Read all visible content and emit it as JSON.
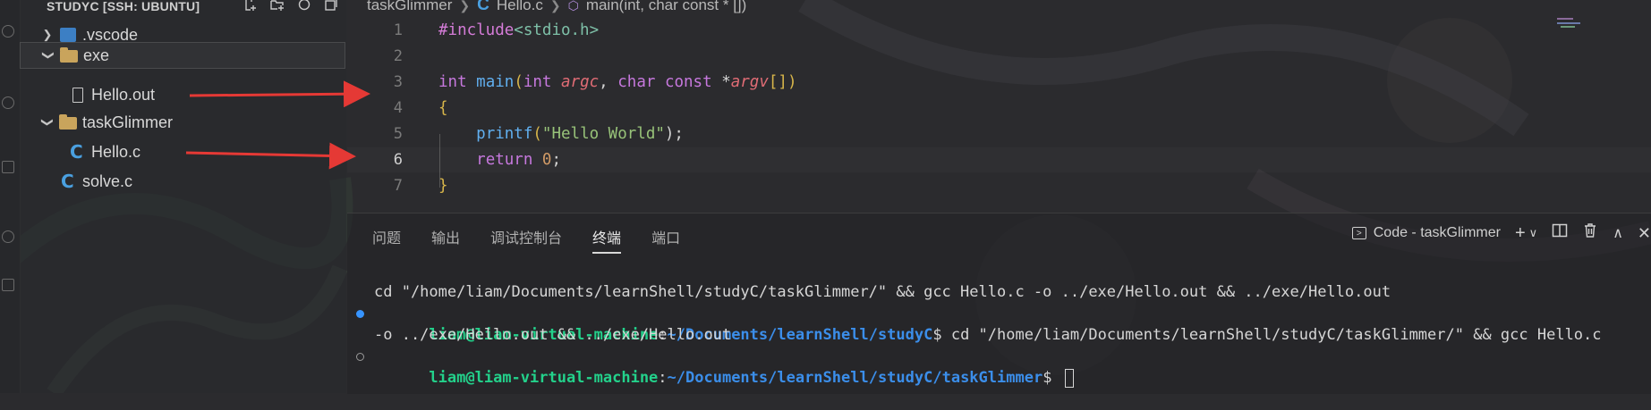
{
  "explorer": {
    "title": "STUDYC [SSH: UBUNTU]",
    "actions": [
      "new-file-icon",
      "new-folder-icon",
      "refresh-icon",
      "collapse-all-icon"
    ],
    "items": [
      {
        "label": ".vscode",
        "type": "folder-vscode",
        "expanded": false
      },
      {
        "label": "exe",
        "type": "folder",
        "expanded": true
      },
      {
        "label": "Hello.out",
        "type": "file"
      },
      {
        "label": "taskGlimmer",
        "type": "folder",
        "expanded": true
      },
      {
        "label": "Hello.c",
        "type": "c-file"
      },
      {
        "label": "solve.c",
        "type": "c-file"
      }
    ]
  },
  "breadcrumb": {
    "folder": "taskGlimmer",
    "file": "Hello.c",
    "symbol": "main(int, char const * [])"
  },
  "editor": {
    "line_numbers": [
      "1",
      "2",
      "3",
      "4",
      "5",
      "6",
      "7"
    ],
    "active_line": "6",
    "code": {
      "l1_directive": "#include",
      "l1_header": "<stdio.h>",
      "l3_int": "int",
      "l3_main": "main",
      "l3_open": "(",
      "l3_int2": "int",
      "l3_argc": "argc",
      "l3_comma": ", ",
      "l3_char": "char",
      "l3_const": "const",
      "l3_star": "*",
      "l3_argv": "argv",
      "l3_close": "[])",
      "l4_brace": "{",
      "l5_printf": "printf",
      "l5_open": "(",
      "l5_str": "\"Hello World\"",
      "l5_close": ");",
      "l6_return": "return",
      "l6_zero": "0",
      "l6_semi": ";",
      "l7_brace": "}"
    }
  },
  "panel": {
    "tabs": [
      "问题",
      "输出",
      "调试控制台",
      "终端",
      "端口"
    ],
    "active_tab": "终端",
    "terminal_name": "Code - taskGlimmer",
    "terminal": {
      "line1": "cd \"/home/liam/Documents/learnShell/studyC/taskGlimmer/\" && gcc Hello.c -o ../exe/Hello.out && ../exe/Hello.out",
      "prompt1_user": "liam@liam-virtual-machine",
      "prompt1_colon": ":",
      "prompt1_path": "~/Documents/learnShell/studyC",
      "prompt1_cmd": "$ cd \"/home/liam/Documents/learnShell/studyC/taskGlimmer/\" && gcc Hello.c",
      "line3": "-o ../exe/Hello.out && ../exe/Hello.out",
      "prompt2_user": "liam@liam-virtual-machine",
      "prompt2_colon": ":",
      "prompt2_path": "~/Documents/learnShell/studyC/taskGlimmer",
      "prompt2_dollar": "$ "
    }
  },
  "colors": {
    "accent_blue": "#3794ff",
    "prompt_green": "#23d18b",
    "arrow_red": "#e53935"
  }
}
